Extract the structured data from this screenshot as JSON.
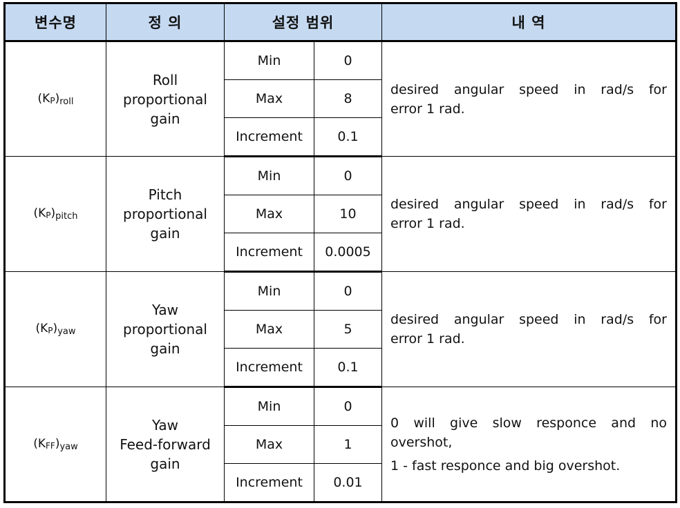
{
  "header": {
    "col_variable": "변수명",
    "col_definition": "정 의",
    "col_range": "설정 범위",
    "col_description": "내 역"
  },
  "colors": {
    "header_bg": "#c5d9f1",
    "border": "#000000"
  },
  "rows": [
    {
      "variable": {
        "base": "(K",
        "sub1": "P",
        "close": ")",
        "sub2": "roll"
      },
      "definition": "Roll\nproportional\ngain",
      "range": [
        {
          "label": "Min",
          "value": "0"
        },
        {
          "label": "Max",
          "value": "8"
        },
        {
          "label": "Increment",
          "value": "0.1"
        }
      ],
      "description": [
        "desired angular speed in rad/s for",
        "error 1 rad."
      ]
    },
    {
      "variable": {
        "base": "(K",
        "sub1": "P",
        "close": ")",
        "sub2": "pitch"
      },
      "definition": "Pitch\nproportional\ngain",
      "range": [
        {
          "label": "Min",
          "value": "0"
        },
        {
          "label": "Max",
          "value": "10"
        },
        {
          "label": "Increment",
          "value": "0.0005"
        }
      ],
      "description": [
        "desired angular speed in rad/s for",
        "error 1 rad."
      ]
    },
    {
      "variable": {
        "base": "(K",
        "sub1": "P",
        "close": ")",
        "sub2": "yaw"
      },
      "definition": "Yaw\nproportional\ngain",
      "range": [
        {
          "label": "Min",
          "value": "0"
        },
        {
          "label": "Max",
          "value": "5"
        },
        {
          "label": "Increment",
          "value": "0.1"
        }
      ],
      "description": [
        "desired angular speed in rad/s for",
        "error 1 rad."
      ]
    },
    {
      "variable": {
        "base": "(K",
        "sub1": "FF",
        "close": ")",
        "sub2": "yaw"
      },
      "definition": "Yaw\nFeed-forward\ngain",
      "range": [
        {
          "label": "Min",
          "value": "0"
        },
        {
          "label": "Max",
          "value": "1"
        },
        {
          "label": "Increment",
          "value": "0.01"
        }
      ],
      "description": [
        "0 will give slow responce and no",
        "overshot,",
        "1 - fast responce and big overshot."
      ]
    }
  ]
}
